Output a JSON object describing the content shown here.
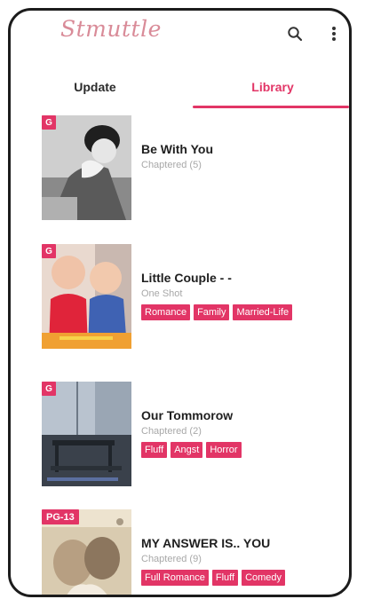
{
  "app": {
    "logo_text": "Stmuttle",
    "accent": "#e23566"
  },
  "appbar": {
    "search_icon": "search-icon",
    "more_icon": "more-vertical-icon"
  },
  "tabs": [
    {
      "label": "Update",
      "active": false
    },
    {
      "label": "Library",
      "active": true
    }
  ],
  "stories": [
    {
      "rating": "G",
      "title": "Be With You",
      "subtitle": "Chaptered (5)",
      "tags": []
    },
    {
      "rating": "G",
      "title": "Little Couple - -",
      "subtitle": "One Shot",
      "tags": [
        "Romance",
        "Family",
        "Married-Life"
      ]
    },
    {
      "rating": "G",
      "title": "Our Tommorow",
      "subtitle": "Chaptered (2)",
      "tags": [
        "Fluff",
        "Angst",
        "Horror"
      ]
    },
    {
      "rating": "PG-13",
      "title": "MY ANSWER IS.. YOU",
      "subtitle": "Chaptered (9)",
      "tags": [
        "Full Romance",
        "Fluff",
        "Comedy"
      ]
    }
  ]
}
